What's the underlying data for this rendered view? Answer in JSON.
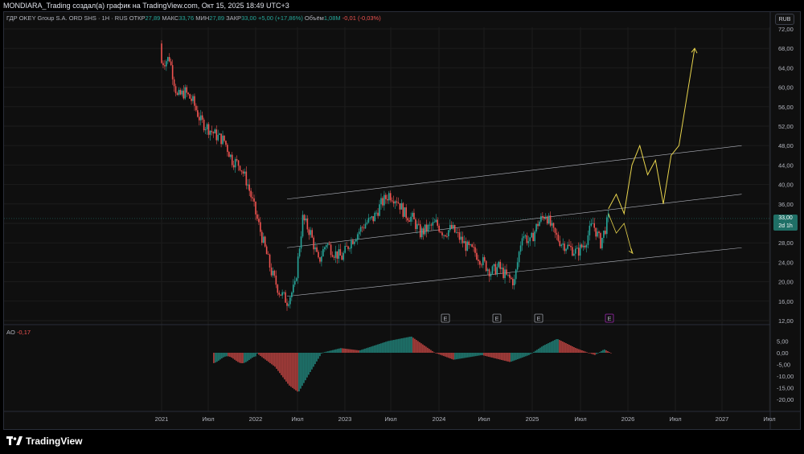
{
  "header": {
    "attribution": "MONDIARA_Trading создал(а) график на TradingView.com, Окт 15, 2025 18:49 UTC+3"
  },
  "legend": {
    "symbol": "ГДР OKEY Group S.A. ORD SHS · 1Н · RUS",
    "open_label": "ОТКР",
    "open": "27,89",
    "high_label": "МАКС",
    "high": "33,76",
    "low_label": "МИН",
    "low": "27,89",
    "close_label": "ЗАКР",
    "close": "33,00",
    "change": "+5,00 (+17,86%)",
    "volume_label": "Объём",
    "volume": "1,08M",
    "volume_change": "-0,01 (-0,03%)"
  },
  "currency_button": "RUB",
  "price_axis": [
    "72,00",
    "68,00",
    "64,00",
    "60,00",
    "56,00",
    "52,00",
    "48,00",
    "44,00",
    "40,00",
    "36,00",
    "32,00",
    "28,00",
    "24,00",
    "20,00",
    "16,00",
    "12,00"
  ],
  "price_marker": {
    "value": "33,00",
    "countdown": "2d 1h"
  },
  "ao_legend": {
    "name": "AO",
    "value": "-0,17"
  },
  "ao_axis": [
    "0,00",
    "-5,00",
    "-10,00",
    "-15,00",
    "-20,00",
    "5,00"
  ],
  "time_axis": [
    "2021",
    "Июл",
    "2022",
    "Июл",
    "2023",
    "Июл",
    "2024",
    "Июл",
    "2025",
    "Июл",
    "2026",
    "Июл",
    "2027",
    "Июл"
  ],
  "earnings_markers": [
    "E",
    "E",
    "E",
    "E"
  ],
  "brand": {
    "name": "TradingView"
  },
  "colors": {
    "up": "#26a69a",
    "down": "#ef5350",
    "projection": "#e8d44d",
    "channel": "#b2b5be",
    "price_tag": "#1f6f66",
    "earnings_highlight": "#9c27b0"
  },
  "chart_data": {
    "type": "candlestick",
    "title": "ГДР OKEY Group S.A. ORD SHS · 1Н · RUS",
    "x_range": [
      "2020-10",
      "2027-08"
    ],
    "ylim": [
      12,
      74
    ],
    "price_path": [
      [
        "2021-01",
        69
      ],
      [
        "2021-01",
        65
      ],
      [
        "2021-02",
        66
      ],
      [
        "2021-03",
        58
      ],
      [
        "2021-04",
        59
      ],
      [
        "2021-05",
        57
      ],
      [
        "2021-06",
        53
      ],
      [
        "2021-08",
        50
      ],
      [
        "2021-09",
        49
      ],
      [
        "2021-10",
        45
      ],
      [
        "2021-11",
        44
      ],
      [
        "2021-12",
        40
      ],
      [
        "2022-01",
        34
      ],
      [
        "2022-02",
        28
      ],
      [
        "2022-03",
        22
      ],
      [
        "2022-04",
        18
      ],
      [
        "2022-05",
        16
      ],
      [
        "2022-06",
        19
      ],
      [
        "2022-07",
        33
      ],
      [
        "2022-08",
        30
      ],
      [
        "2022-09",
        24
      ],
      [
        "2022-10",
        28
      ],
      [
        "2022-11",
        26
      ],
      [
        "2022-12",
        25
      ],
      [
        "2023-01",
        28
      ],
      [
        "2023-02",
        30
      ],
      [
        "2023-03",
        32
      ],
      [
        "2023-04",
        33
      ],
      [
        "2023-05",
        36
      ],
      [
        "2023-06",
        38
      ],
      [
        "2023-07",
        37
      ],
      [
        "2023-08",
        34
      ],
      [
        "2023-09",
        33
      ],
      [
        "2023-10",
        30
      ],
      [
        "2023-11",
        31
      ],
      [
        "2023-12",
        32
      ],
      [
        "2024-01",
        30
      ],
      [
        "2024-02",
        31
      ],
      [
        "2024-03",
        29
      ],
      [
        "2024-04",
        27
      ],
      [
        "2024-05",
        26
      ],
      [
        "2024-06",
        24
      ],
      [
        "2024-07",
        22
      ],
      [
        "2024-08",
        23
      ],
      [
        "2024-09",
        21
      ],
      [
        "2024-10",
        20
      ],
      [
        "2024-11",
        30
      ],
      [
        "2024-12",
        28
      ],
      [
        "2025-01",
        32
      ],
      [
        "2025-02",
        34
      ],
      [
        "2025-03",
        30
      ],
      [
        "2025-04",
        28
      ],
      [
        "2025-05",
        27
      ],
      [
        "2025-06",
        26
      ],
      [
        "2025-07",
        28
      ],
      [
        "2025-08",
        32
      ],
      [
        "2025-09",
        28
      ],
      [
        "2025-10",
        33
      ]
    ],
    "projection_up": [
      [
        "2025-10",
        35
      ],
      [
        "2025-11",
        38
      ],
      [
        "2025-12",
        34
      ],
      [
        "2026-01",
        44
      ],
      [
        "2026-02",
        48
      ],
      [
        "2026-03",
        42
      ],
      [
        "2026-04",
        45
      ],
      [
        "2026-05",
        36
      ],
      [
        "2026-06",
        46
      ],
      [
        "2026-07",
        48
      ],
      [
        "2026-09",
        68
      ]
    ],
    "projection_down": [
      [
        "2025-10",
        34
      ],
      [
        "2025-11",
        30
      ],
      [
        "2025-12",
        32
      ],
      [
        "2026-01",
        26
      ]
    ],
    "channel_lines": [
      {
        "from": [
          "2022-05",
          37
        ],
        "to": [
          "2027-03",
          48
        ]
      },
      {
        "from": [
          "2022-05",
          27
        ],
        "to": [
          "2027-03",
          38
        ]
      },
      {
        "from": [
          "2022-05",
          17
        ],
        "to": [
          "2027-03",
          27
        ]
      }
    ],
    "ao_series_range": [
      -17,
      6
    ]
  }
}
